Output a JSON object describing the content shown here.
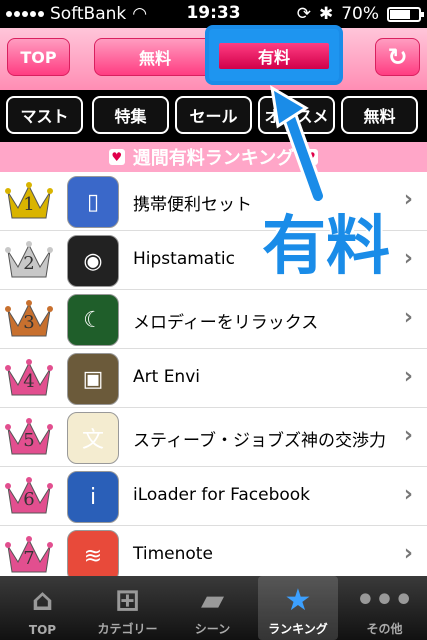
{
  "status_bar": {
    "carrier": "SoftBank",
    "time": "19:33",
    "battery": "70%",
    "battery_level": 0.7
  },
  "nav": {
    "top_label": "TOP",
    "free_label": "無料",
    "paid_label": "有料",
    "refresh_icon": "refresh-icon"
  },
  "categories": [
    "マスト",
    "特集",
    "セール",
    "オススメ",
    "無料"
  ],
  "ranking_title": "週間有料ランキング",
  "overlay_label": "有料",
  "apps": [
    {
      "rank": "1",
      "name": "携帯便利セット",
      "crown": "#d9b400",
      "icon_bg": "#3a68c9",
      "icon": "phone-icon"
    },
    {
      "rank": "2",
      "name": "Hipstamatic",
      "crown": "#c8c8c8",
      "icon_bg": "#222222",
      "icon": "camera-icon"
    },
    {
      "rank": "3",
      "name": "メロディーをリラックス",
      "crown": "#c8702e",
      "icon_bg": "#1f5e2a",
      "icon": "moon-icon"
    },
    {
      "rank": "4",
      "name": "Art Envi",
      "crown": "#e24f8f",
      "icon_bg": "#6b5a3a",
      "icon": "painting-icon"
    },
    {
      "rank": "5",
      "name": "スティーブ・ジョブズ神の交渉力",
      "crown": "#e24f8f",
      "icon_bg": "#f4ecd0",
      "icon": "book-icon"
    },
    {
      "rank": "6",
      "name": "iLoader for Facebook",
      "crown": "#e24f8f",
      "icon_bg": "#2a5fb8",
      "icon": "loader-icon"
    },
    {
      "rank": "7",
      "name": "Timenote",
      "crown": "#e24f8f",
      "icon_bg": "#e84a3a",
      "icon": "rainbow-icon"
    }
  ],
  "tabs": [
    {
      "label": "TOP",
      "icon": "house-icon"
    },
    {
      "label": "カテゴリー",
      "icon": "tree-icon"
    },
    {
      "label": "シーン",
      "icon": "clapper-icon"
    },
    {
      "label": "ランキング",
      "icon": "star-icon"
    },
    {
      "label": "その他",
      "icon": "more-icon"
    }
  ]
}
